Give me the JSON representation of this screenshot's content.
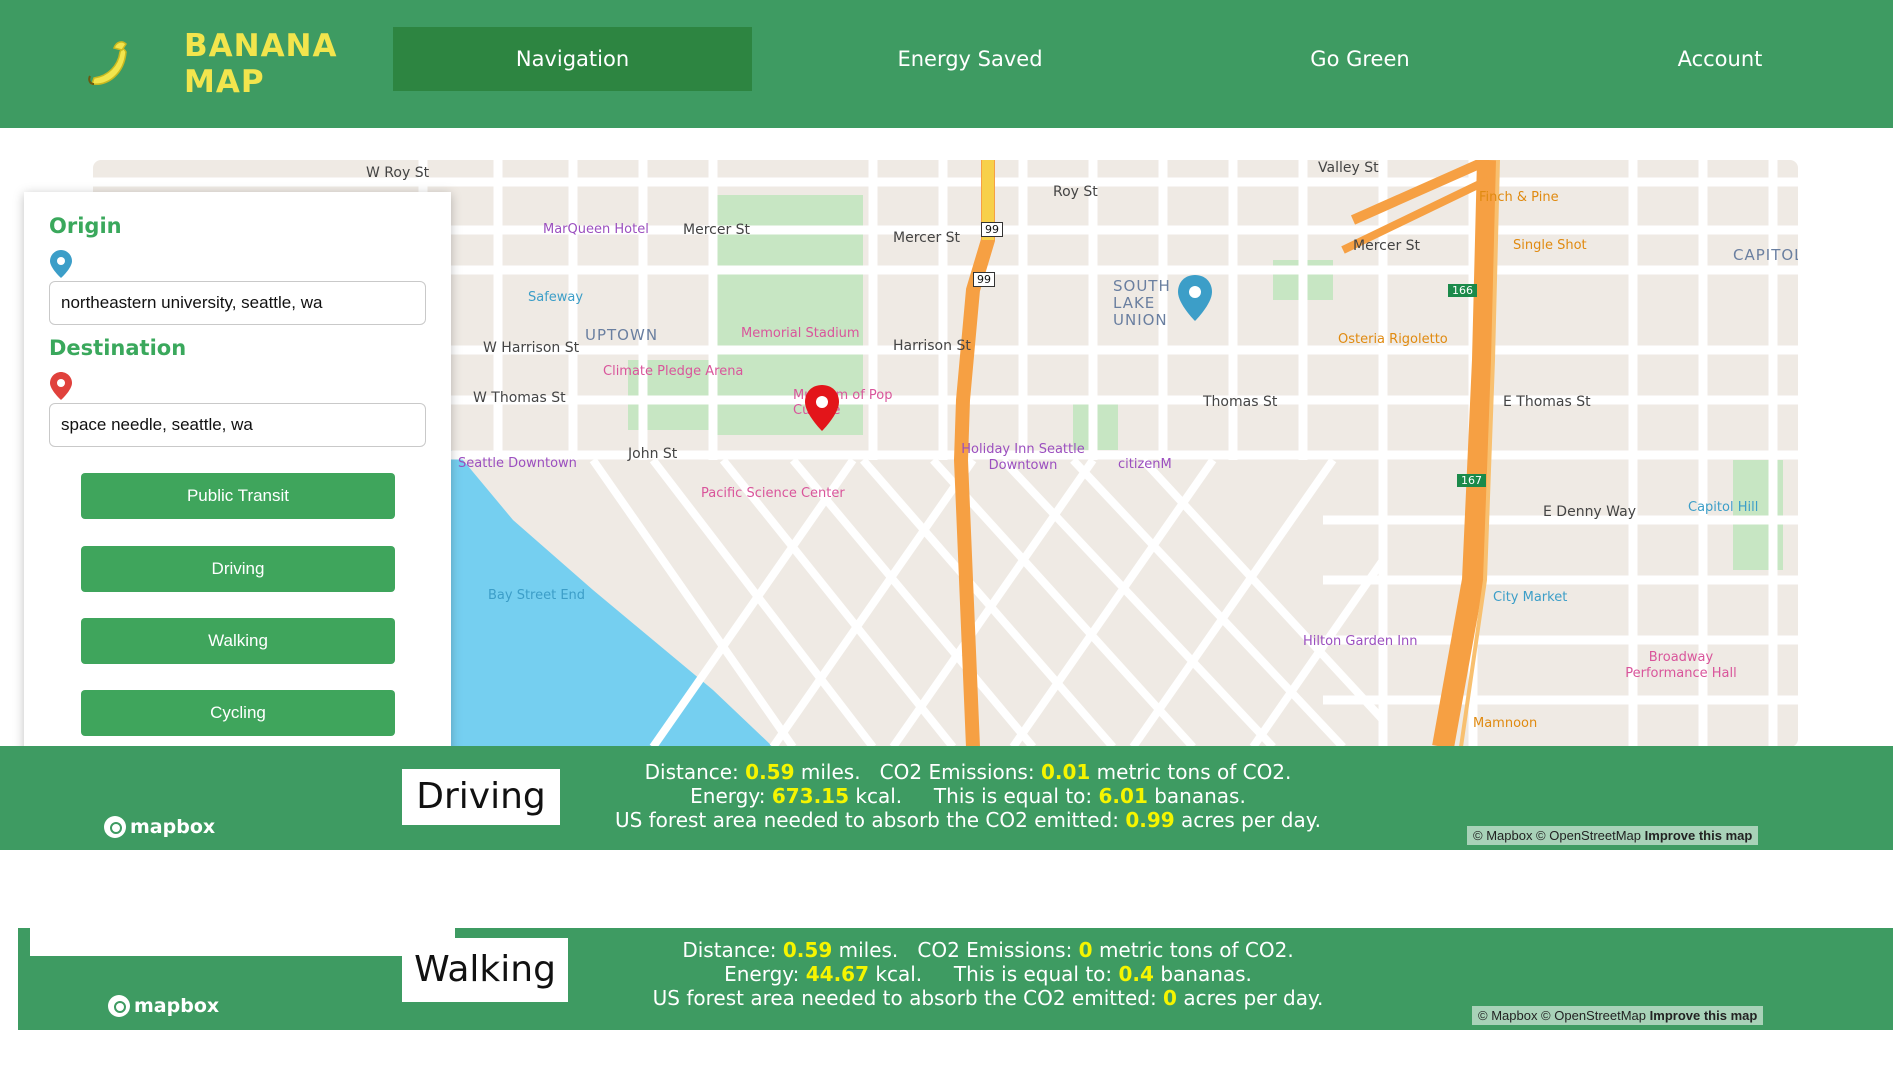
{
  "header": {
    "logo_line1": "BANANA",
    "logo_line2": "MAP",
    "nav": [
      {
        "label": "Navigation"
      },
      {
        "label": "Energy Saved"
      },
      {
        "label": "Go Green"
      },
      {
        "label": "Account"
      }
    ]
  },
  "panel": {
    "origin_label": "Origin",
    "origin_value": "northeastern university, seattle, wa",
    "destination_label": "Destination",
    "destination_value": "space needle, seattle, wa",
    "modes": [
      {
        "label": "Public Transit"
      },
      {
        "label": "Driving"
      },
      {
        "label": "Walking"
      },
      {
        "label": "Cycling"
      }
    ]
  },
  "map": {
    "streets": [
      "W Roy St",
      "Mercer St",
      "W Harrison St",
      "W Thomas St",
      "John St",
      "Harrison St",
      "Thomas St",
      "Roy St",
      "Valley St",
      "E Thomas St",
      "E Denny Way",
      "Mercer St",
      "Mercer St"
    ],
    "pois": [
      "MarQueen Hotel",
      "Safeway",
      "UPTOWN",
      "Memorial Stadium",
      "Climate Pledge Arena",
      "Museum of Pop Culture",
      "Pacific Science Center",
      "Holiday Inn Seattle Downtown",
      "citizenM",
      "SOUTH LAKE UNION",
      "Osteria Rigoletto",
      "Single Shot",
      "Finch & Pine",
      "CAPITOL HILL",
      "Capitol Hill",
      "City Market",
      "Hilton Garden Inn",
      "Broadway Performance Hall",
      "Mamnoon",
      "Bay Street End",
      "Seattle Downtown"
    ],
    "shields": [
      "99",
      "99",
      "166",
      "167"
    ],
    "attribution": "© Mapbox © OpenStreetMap",
    "improve": "Improve this map",
    "brand": "mapbox"
  },
  "results": [
    {
      "mode": "Driving",
      "distance": "0.59",
      "co2": "0.01",
      "energy": "673.15",
      "bananas": "6.01",
      "acres": "0.99"
    },
    {
      "mode": "Walking",
      "distance": "0.59",
      "co2": "0",
      "energy": "44.67",
      "bananas": "0.4",
      "acres": "0"
    }
  ],
  "text": {
    "distance_label": "Distance:",
    "miles": "miles.",
    "co2_label": "CO2 Emissions:",
    "co2_unit": "metric tons of CO2.",
    "energy_label": "Energy:",
    "kcal": "kcal.",
    "equal_label": "This is equal to:",
    "bananas_unit": "bananas.",
    "forest_label": "US forest area needed to absorb the CO2 emitted:",
    "acres_unit": "acres per day."
  },
  "colors": {
    "header": "#3e9b62",
    "nav_active": "#2d8541",
    "logo_text": "#f2e54d",
    "button": "#3fa55c",
    "value_highlight": "#f5f500"
  }
}
